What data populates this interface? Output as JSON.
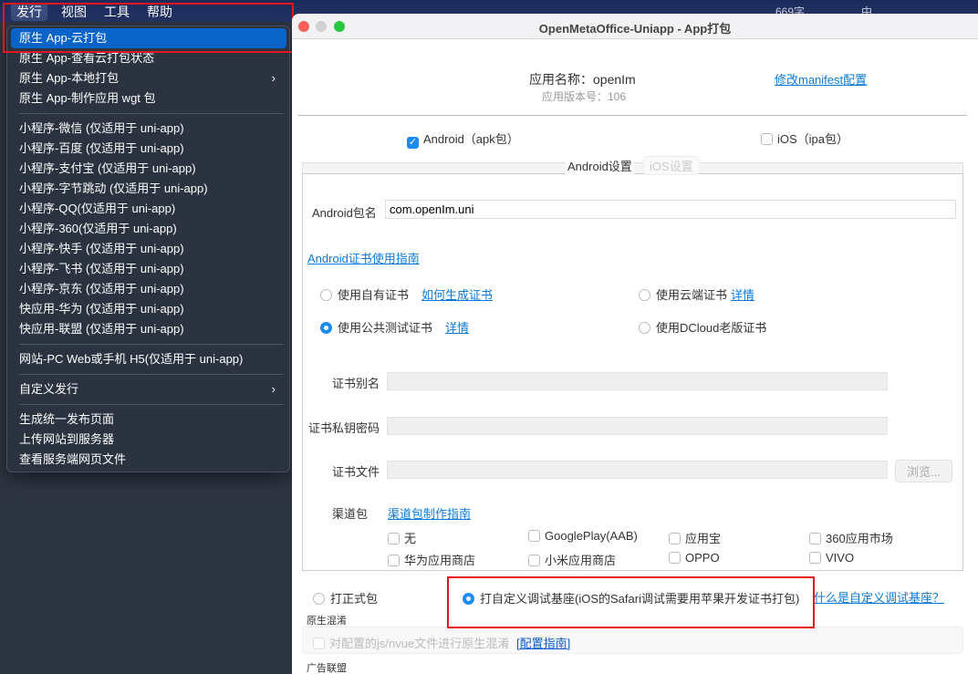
{
  "menubar": {
    "items": [
      "发行",
      "视图",
      "工具",
      "帮助"
    ],
    "tray": {
      "word_count": "669字",
      "ime": "中"
    }
  },
  "menu": {
    "items": [
      {
        "label": "原生 App-云打包",
        "highlighted": true
      },
      {
        "label": "原生 App-查看云打包状态"
      },
      {
        "label": "原生 App-本地打包",
        "submenu": true
      },
      {
        "label": "原生 App-制作应用 wgt 包"
      },
      {
        "label": "小程序-微信 (仅适用于 uni-app)"
      },
      {
        "label": "小程序-百度 (仅适用于 uni-app)"
      },
      {
        "label": "小程序-支付宝 (仅适用于 uni-app)"
      },
      {
        "label": "小程序-字节跳动 (仅适用于 uni-app)"
      },
      {
        "label": "小程序-QQ(仅适用于 uni-app)"
      },
      {
        "label": "小程序-360(仅适用于 uni-app)"
      },
      {
        "label": "小程序-快手 (仅适用于 uni-app)"
      },
      {
        "label": "小程序-飞书 (仅适用于 uni-app)"
      },
      {
        "label": "小程序-京东 (仅适用于 uni-app)"
      },
      {
        "label": "快应用-华为 (仅适用于 uni-app)"
      },
      {
        "label": "快应用-联盟 (仅适用于 uni-app)"
      },
      {
        "label": "网站-PC Web或手机 H5(仅适用于 uni-app)"
      },
      {
        "label": "自定义发行",
        "submenu": true
      },
      {
        "label": "生成统一发布页面"
      },
      {
        "label": "上传网站到服务器"
      },
      {
        "label": "查看服务端网页文件"
      }
    ],
    "arrow": "›"
  },
  "window": {
    "title": "OpenMetaOffice-Uniapp - App打包",
    "app_name": "应用名称：openIm",
    "app_version": "应用版本号：106",
    "manifest_link": "修改manifest配置",
    "platforms": [
      {
        "label": "Android（apk包）",
        "checked": true
      },
      {
        "label": "iOS（ipa包）",
        "checked": false
      }
    ],
    "tabs": [
      {
        "label": "Android设置",
        "active": true
      },
      {
        "label": "iOS设置",
        "active": false
      }
    ],
    "package_label": "Android包名",
    "package_value": "com.openIm.uni",
    "cert_guide": "Android证书使用指南",
    "cert_options": [
      {
        "label": "使用自有证书",
        "link": "如何生成证书",
        "selected": false
      },
      {
        "label": "使用云端证书",
        "link": "详情",
        "selected": false
      },
      {
        "label": "使用公共测试证书",
        "link": "详情",
        "selected": true
      },
      {
        "label": "使用DCloud老版证书",
        "selected": false
      }
    ],
    "cert_alias": "证书别名",
    "cert_password": "证书私钥密码",
    "cert_file": "证书文件",
    "browse": "浏览...",
    "channel_label": "渠道包",
    "channel_guide": "渠道包制作指南",
    "channels": [
      "无",
      "GooglePlay(AAB)",
      "应用宝",
      "360应用市场",
      "华为应用商店",
      "小米应用商店",
      "OPPO",
      "VIVO"
    ],
    "build_types": [
      {
        "label": "打正式包",
        "selected": false
      },
      {
        "label": "打自定义调试基座(iOS的Safari调试需要用苹果开发证书打包)",
        "selected": true
      }
    ],
    "debug_link": "什么是自定义调试基座？",
    "obfuscation_title": "原生混淆",
    "obfuscation_label": "对配置的js/nvue文件进行原生混淆",
    "obfuscation_link": "[配置指南]",
    "ads_title": "广告联盟"
  },
  "colors": {
    "accent": "#1a8cf0",
    "highlight": "#0a63c9",
    "annotation": "#e5141e"
  }
}
